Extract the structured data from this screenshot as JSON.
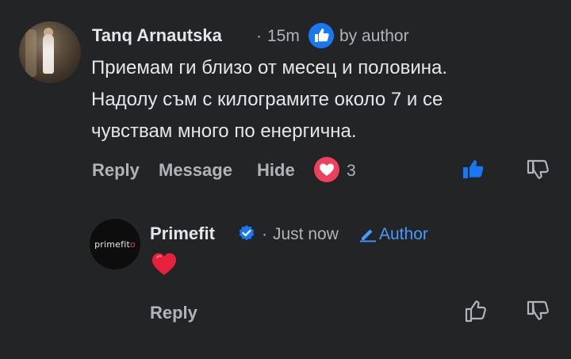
{
  "comment": {
    "author_name": "Tanq Arnautska",
    "separator": "·",
    "time": "15m",
    "liked_by": "by author",
    "text_lines": [
      "Приемам ги близо от месец и половина.",
      "Надолу съм с килограмите около 7 и се",
      "чувствам много по енергична."
    ],
    "actions": {
      "reply": "Reply",
      "message": "Message",
      "hide": "Hide"
    },
    "reaction_count": "3",
    "liked": true
  },
  "reply": {
    "author_name": "Primefit",
    "verified": true,
    "separator": "·",
    "time": "Just now",
    "author_badge": "Author",
    "content_emoji": "red-heart",
    "actions": {
      "reply": "Reply"
    },
    "avatar_logo": {
      "text": "primefit",
      "mark": "o"
    }
  },
  "colors": {
    "background": "#232425",
    "primary_text": "#e4e6eb",
    "secondary_text": "#b0b3b8",
    "accent_blue": "#1877f2",
    "link_blue": "#4599ff",
    "heart_red": "#f0415c"
  }
}
